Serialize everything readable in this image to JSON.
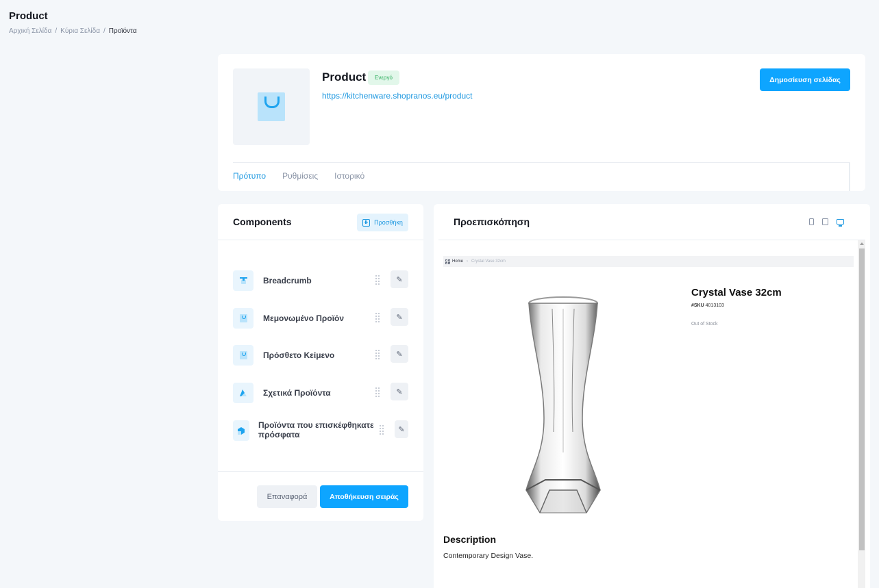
{
  "page": {
    "title": "Product",
    "breadcrumb": [
      "Αρχική Σελίδα",
      "Κύρια Σελίδα",
      "Προϊόντα"
    ],
    "breadcrumb_separator": "/"
  },
  "header": {
    "product_name": "Product",
    "status": "Ενεργό",
    "url": "https://kitchenware.shopranos.eu/product",
    "publish_label": "Δημοσίευση σελίδας",
    "tabs": [
      {
        "label": "Πρότυπο",
        "active": true
      },
      {
        "label": "Ρυθμίσεις",
        "active": false
      },
      {
        "label": "Ιστορικό",
        "active": false
      }
    ]
  },
  "components": {
    "title": "Components",
    "add_label": "Προσθήκη",
    "items": [
      {
        "label": "Breadcrumb",
        "icon": "breadcrumb-icon"
      },
      {
        "label": "Μεμονωμένο Προϊόν",
        "icon": "bag-icon"
      },
      {
        "label": "Πρόσθετο Κείμενο",
        "icon": "bag-icon"
      },
      {
        "label": "Σχετικά Προϊόντα",
        "icon": "related-products-icon"
      },
      {
        "label": "Προϊόντα που επισκέφθηκατε πρόσφατα",
        "icon": "recent-products-icon"
      }
    ],
    "reset_label": "Επαναφορά",
    "save_label": "Αποθήκευση σειράς"
  },
  "preview": {
    "title": "Προεπισκόπηση",
    "devices": [
      "phone-icon",
      "tablet-icon",
      "desktop-icon"
    ],
    "active_device": "desktop",
    "breadcrumb_home": "Home",
    "breadcrumb_current": "Crystal Vase 32cm",
    "product_name": "Crystal Vase 32cm",
    "sku_label": "#SKU",
    "sku_value": "4013103",
    "stock_status": "Out of Stock",
    "description_title": "Description",
    "description_text": "Contemporary Design Vase."
  },
  "colors": {
    "accent": "#0ea5ff",
    "link": "#1e98e0",
    "status_bg": "#e2f7ea",
    "status_text": "#2eae5e",
    "background": "#f4f7fa"
  }
}
